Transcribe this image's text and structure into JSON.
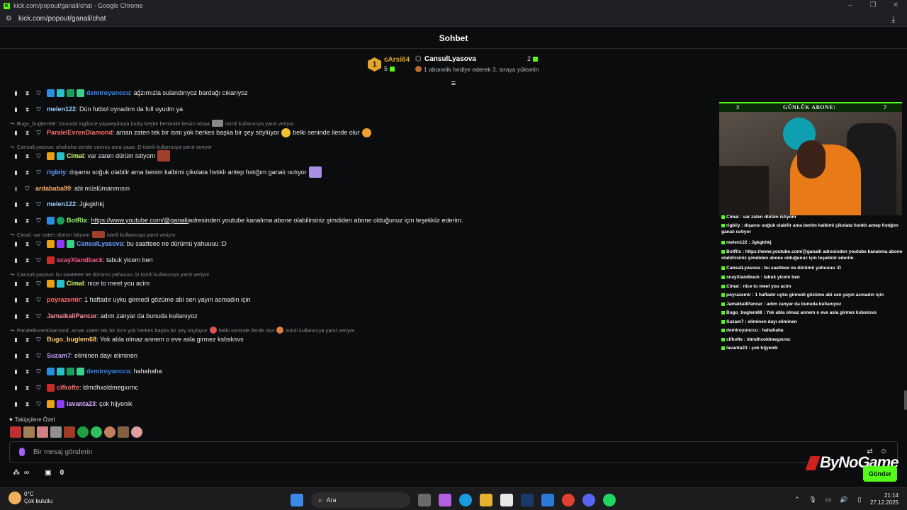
{
  "window": {
    "title": "kick.com/popout/ganali/chat - Google Chrome",
    "url": "kick.com/popout/ganali/chat"
  },
  "header": {
    "title": "Sohbet"
  },
  "leaderboard": {
    "rank": "1",
    "top_user": "cArsi64",
    "top_count": "5",
    "gifter": "CansulLyasova",
    "gifter_count": "2",
    "gifter_sub": "1 abonelik hediye ederek 3. sıraya yükselin"
  },
  "messages": [
    {
      "user": "demiroyunccu",
      "color": "#3b8af0",
      "text": ": ağzımızla sulandırıyoz bardağı cıkarıyoz"
    },
    {
      "user": "melen122",
      "color": "#9fd3ff",
      "text": ": Dün futbol oynadım da full uyudm ya"
    },
    {
      "user": "ParalelEvrenDiamond",
      "color": "#ff6a6a",
      "text": ": aman zaten tek bir ismi yok herkes başka bir şey söylüyor",
      "text2": " belki seninde ilerde olur"
    },
    {
      "user": "Cimal",
      "color": "#d9ff6a",
      "text": ": var zaten dürüm istiyom"
    },
    {
      "user": "rigbiiy",
      "color": "#6a9aff",
      "text": ": dışarısı soğuk olabilir ama benim kalbimi çikolata fıstıklı antep fıstığım ganalı ısıtıyor"
    },
    {
      "user": "ardababa99",
      "color": "#ffb26a",
      "text": ": abi müslümanmısın"
    },
    {
      "user": "melen122",
      "color": "#9fd3ff",
      "text": ": Jgkgkhkj"
    },
    {
      "user": "BotRix",
      "color": "#9dff6a",
      "link": "https://www.youtube.com/@ganalii",
      "text": " adresinden youtube kanalıma abone olabilirsiniz şimdiden abone olduğunuz için teşekkür ederim."
    },
    {
      "user": "CansulLyasova",
      "color": "#6aa0ff",
      "text": ": bu saatteee ne dürümü yahuuuu :D"
    },
    {
      "user": "scayXlandback",
      "color": "#ff5a8a",
      "text": ": tabuk yicem ben"
    },
    {
      "user": "Cimal",
      "color": "#d9ff6a",
      "text": ": nice to meet you acim"
    },
    {
      "user": "poyrazemir",
      "color": "#ff6a6a",
      "text": ": 1 haftadır uyku girmedi gözüme abi sen yayın acmadın için"
    },
    {
      "user": "JamaikaliPancar",
      "color": "#ff8a9a",
      "text": ": adım zanyar da bunuda kullanıyoz"
    },
    {
      "user": "Bugo_buglem68",
      "color": "#ffc86a",
      "text": ": Yok abla olmaz annem o eve asla girmez ksbsksvs"
    },
    {
      "user": "Suzam7",
      "color": "#c89aff",
      "text": ": eliminen dayı eliminen"
    },
    {
      "user": "demiroyunccu",
      "color": "#3b8af0",
      "text": ": hahahaha"
    },
    {
      "user": "cifkofte",
      "color": "#ff6a6a",
      "text": ": ldmdhxoldmegxırnc"
    },
    {
      "user": "lavanta23",
      "color": "#d6a8ff",
      "text": ": çok hijyenik"
    }
  ],
  "replies": [
    {
      "text": "Bugo_buglem68: Onunda ingilizce yapaaydınya lucky keşke benimde kesim olsaa",
      "suffix": "isimli kullanıcıya yanıt veriyor"
    },
    {
      "text": "CansulLyasova: ahahaha sende varmıs ama yaaa :D isimli kullanıcıya yanıt veriyor",
      "suffix": ""
    },
    {
      "text": "Cimal: var zaten dürüm istiyom",
      "suffix": "isimli kullanıcıya yanıt veriyor"
    },
    {
      "text": "CansulLyasova: bu saatteee ne dürümü yahuuuu :D isimli kullanıcıya yanıt veriyor",
      "suffix": ""
    },
    {
      "text": "ParalelEvrenDiamond: aman zaten tek bir ismi yok herkes başka bir şey söylüyor",
      "suffix": "belki seninde ilerde olur",
      "suffix2": "isimli kullanıcıya yanıt veriyor"
    }
  ],
  "followers": {
    "label": "Takipçilere Özel"
  },
  "input": {
    "placeholder": "Bir mesaj gönderin"
  },
  "bottom": {
    "count": "0",
    "send_label": "Gönder"
  },
  "watermark": "ByNoGame",
  "overlay": {
    "label_left": "3",
    "label_mid": "GÜNLÜK ABONE:",
    "label_right": "7"
  },
  "mini_chat": [
    "Cimal : var zaten dürüm istiyom",
    "rigbiiy : dışarısı soğuk olabilir ama benim kalbimi çikolata fıstıklı antep fıstığım ganalı ısıtıyor",
    "melen122 : Jgkgkhkj",
    "BotRix : https://www.youtube.com/@ganalii adresinden youtube kanalıma abone olabilirsiniz şimdiden abone olduğunuz için teşekkür ederim.",
    "CansulLyasova : bu saatteee ne dürümü yahuuuu :D",
    "scayXlandback : tabuk yicem ben",
    "Cimal : nice to meet you acim",
    "poyrazemir : 1 haftadır uyku girmedi gözüme abi sen yayın acmadın için",
    "JamaikaliPancar : adım zanyar da bunuda kullanıyoz",
    "Bugo_buglem68 : Yok abla olmaz annem o eve asla girmez ksbsksvs",
    "Suzam7 : eliminen dayı eliminen",
    "demiroyunccu : hahahaha",
    "cifkofte : ldmdhxoldmegxırnc",
    "lavanta23 : çok hijyenik"
  ],
  "taskbar": {
    "temp": "0°C",
    "weather": "Çok bulutlu",
    "search": "Ara",
    "time": "21:14",
    "date": "27.12.2025"
  }
}
